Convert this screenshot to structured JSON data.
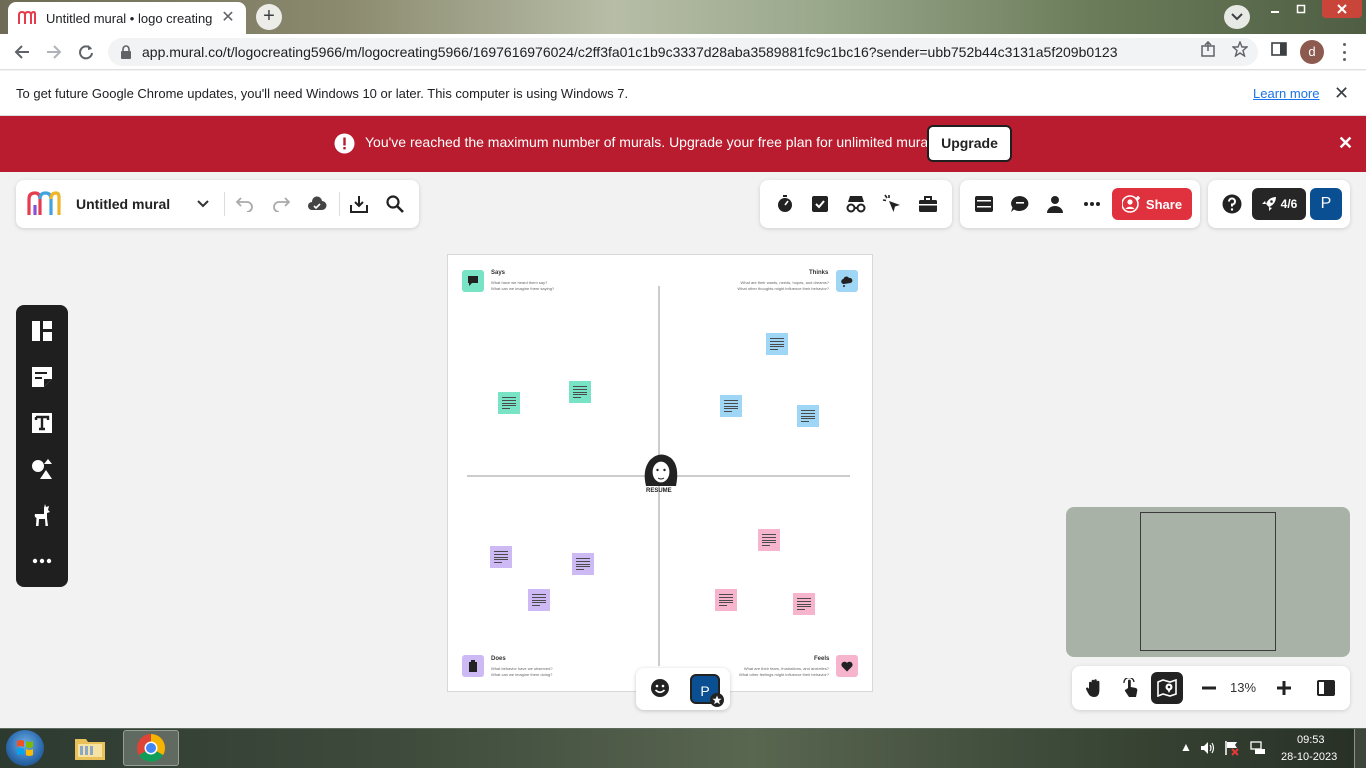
{
  "browser": {
    "tab_title": "Untitled mural • logo creating",
    "url": "app.mural.co/t/logocreating5966/m/logocreating5966/1697616976024/c2ff3fa01c1b9c3337d28aba3589881fc9c1bc16?sender=ubb752b44c3131a5f209b0123",
    "profile_initial": "d"
  },
  "infobar": {
    "message": "To get future Google Chrome updates, you'll need Windows 10 or later. This computer is using Windows 7.",
    "link": "Learn more"
  },
  "banner": {
    "message": "You've reached the maximum number of murals. Upgrade your free plan for unlimited murals.",
    "button": "Upgrade",
    "color": "#b91c2e"
  },
  "mural": {
    "title": "Untitled mural",
    "share_label": "Share",
    "rocket_count": "4/6",
    "user_initial": "P",
    "zoom": "13%"
  },
  "board": {
    "quadrants": [
      {
        "title": "Says",
        "sub1": "What have we heard them say?",
        "sub2": "What can we imagine them saying?"
      },
      {
        "title": "Thinks",
        "sub1": "What are their wants, needs, hopes, and dreams?",
        "sub2": "What other thoughts might influence their behavior?"
      },
      {
        "title": "Does",
        "sub1": "What behavior have we observed?",
        "sub2": "What can we imagine them doing?"
      },
      {
        "title": "Feels",
        "sub1": "What are their fears, frustrations, and anxieties?",
        "sub2": "What other feelings might influence their behavior?"
      }
    ],
    "center_label": "RESUME"
  },
  "taskbar": {
    "time": "09:53",
    "date": "28-10-2023"
  }
}
